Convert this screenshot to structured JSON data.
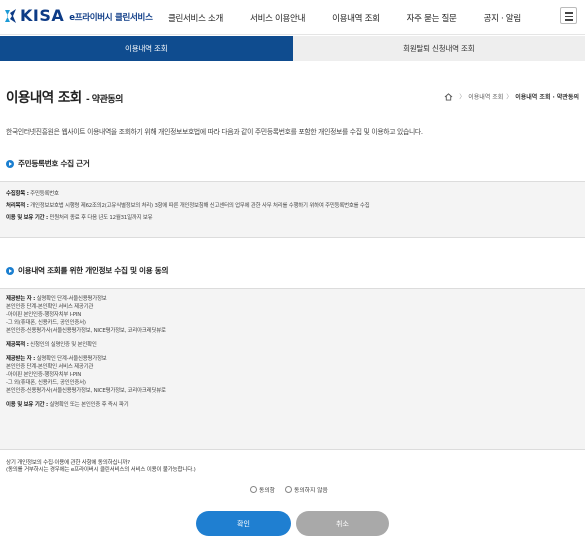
{
  "header": {
    "logo_text": "KISA",
    "logo_sub": "e프라이버시 클린서비스",
    "nav": [
      "클린서비스 소개",
      "서비스 이용안내",
      "이용내역 조회",
      "자주 묻는 질문",
      "공지 · 알림"
    ]
  },
  "tabs": [
    "이용내역 조회",
    "회원탈퇴 신청내역 조회"
  ],
  "page": {
    "title": "이용내역 조회",
    "title_sub": "- 약관동의",
    "breadcrumb": [
      "이용내역 조회",
      "이용내역 조회 · 약관동의"
    ],
    "intro": "한국인터넷진흥원은 웹사이트 이용내역을 조회하기 위해 개인정보보호법에 따라 다음과 같이 주민등록번호를 포함한 개인정보를 수집 및 이용하고 있습니다."
  },
  "section1": {
    "title": "주민등록번호 수집 근거",
    "rows": [
      {
        "label": "수집항목 :",
        "text": " 주민등록번호"
      },
      {
        "label": "처리목적 :",
        "text": " 개인정보보호법 시행령 제62조의2(고유식별정보의 처리) 3항에 따른 개인정보침해 신고센터의 업무에 관한 사무 처리를 수행하기 위하여 주민등록번호를 수집"
      },
      {
        "label": "이용 및 보유 기간 :",
        "text": " 민원처리 종료 후 다음 년도 12월31일까지 보유"
      }
    ]
  },
  "section2": {
    "title": "이용내역 조회를 위한 개인정보 수집 및 이용 동의",
    "block1": {
      "label": "제공받는 자 :",
      "lines": [
        " 실명확인 단계-서울신용평가정보",
        "본인인증 단계-본인확인 서비스 제공기관",
        "-아이핀 본인인증-행정자치부 I-PIN",
        "-그 외(휴대폰, 신용카드, 공인인증서)",
        "본인인증-신용평가사(서울신용평가정보, NICE평가정보, 코리아크레딧뷰로"
      ]
    },
    "purpose_label": "제공목적 :",
    "purpose_text": " 신청인의 실명인증 및 본인확인",
    "block2": {
      "label": "제공받는 자 :",
      "lines": [
        " 실명확인 단계-서울신용평가정보",
        "본인인증 단계-본인확인 서비스 제공기관",
        "-아이핀 본인인증-행정자치부 I-PIN",
        "-그 외(휴대폰, 신용카드, 공인인증서)",
        "본인인증-신용평가사(서울신용평가정보, NICE평가정보, 코리아크레딧뷰로"
      ]
    },
    "period_label": "이용 및 보유 기간 :",
    "period_text": " 실명확인 또는 본인인증 후 즉시 파기"
  },
  "consent": {
    "question": "상기 개인정보의 수집·이용에 관한 사항에 동의하십니까?",
    "note": "(동의를 거부하시는 경우에는 e프라이버시 클린서비스의 서비스 이용이 불가능합니다.)",
    "agree": "동의함",
    "disagree": "동의하지 않음"
  },
  "buttons": {
    "confirm": "확인",
    "cancel": "취소"
  },
  "colors": {
    "primary": "#0f4c8f",
    "accent": "#1f7fd1"
  },
  "icons": [
    "home-icon",
    "menu-icon",
    "section-bullet-icon"
  ]
}
